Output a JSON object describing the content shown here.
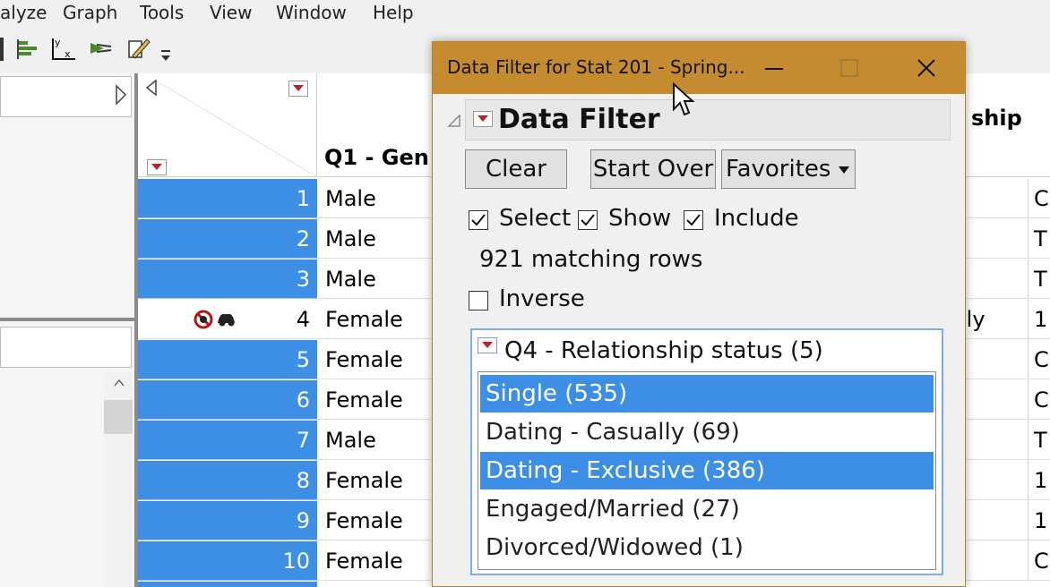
{
  "menubar": {
    "items": [
      "alyze",
      "Graph",
      "Tools",
      "View",
      "Window",
      "Help"
    ]
  },
  "toolbar": {
    "icons": [
      "bar-chart-icon",
      "y-by-x-icon",
      "arrows-icon",
      "edit-icon",
      "overflow-icon"
    ]
  },
  "table": {
    "columns": {
      "q1": "Q1 - Gen",
      "q4_partial": "ship"
    },
    "rows": [
      {
        "num": "1",
        "gender": "Male",
        "right": "",
        "far": "C",
        "selected": true
      },
      {
        "num": "2",
        "gender": "Male",
        "right": "",
        "far": "T",
        "selected": true
      },
      {
        "num": "3",
        "gender": "Male",
        "right": "",
        "far": "T",
        "selected": true
      },
      {
        "num": "4",
        "gender": "Female",
        "right": "lly",
        "far": "1",
        "selected": false
      },
      {
        "num": "5",
        "gender": "Female",
        "right": "",
        "far": "C",
        "selected": true
      },
      {
        "num": "6",
        "gender": "Female",
        "right": "",
        "far": "C",
        "selected": true
      },
      {
        "num": "7",
        "gender": "Male",
        "right": "",
        "far": "T",
        "selected": true
      },
      {
        "num": "8",
        "gender": "Female",
        "right": "",
        "far": "1",
        "selected": true
      },
      {
        "num": "9",
        "gender": "Female",
        "right": "",
        "far": "1",
        "selected": true
      },
      {
        "num": "10",
        "gender": "Female",
        "right": "",
        "far": "C",
        "selected": true
      }
    ]
  },
  "dialog": {
    "title": "Data Filter for Stat 201 - Spring...",
    "section_title": "Data Filter",
    "buttons": {
      "clear": "Clear",
      "start_over": "Start Over",
      "favorites": "Favorites"
    },
    "checkboxes": {
      "select": "Select",
      "show": "Show",
      "include": "Include",
      "inverse": "Inverse"
    },
    "matching_text": "921 matching rows",
    "filter": {
      "title": "Q4 - Relationship status (5)",
      "items": [
        {
          "label": "Single (535)",
          "selected": true
        },
        {
          "label": "Dating - Casually (69)",
          "selected": false
        },
        {
          "label": "Dating - Exclusive (386)",
          "selected": true
        },
        {
          "label": "Engaged/Married (27)",
          "selected": false
        },
        {
          "label": "Divorced/Widowed (1)",
          "selected": false
        }
      ]
    }
  },
  "colors": {
    "titlebar": "#c48c2e",
    "selection": "#3d8fe6",
    "filter_border": "#7aaee8",
    "red_triangle": "#c0202a"
  }
}
